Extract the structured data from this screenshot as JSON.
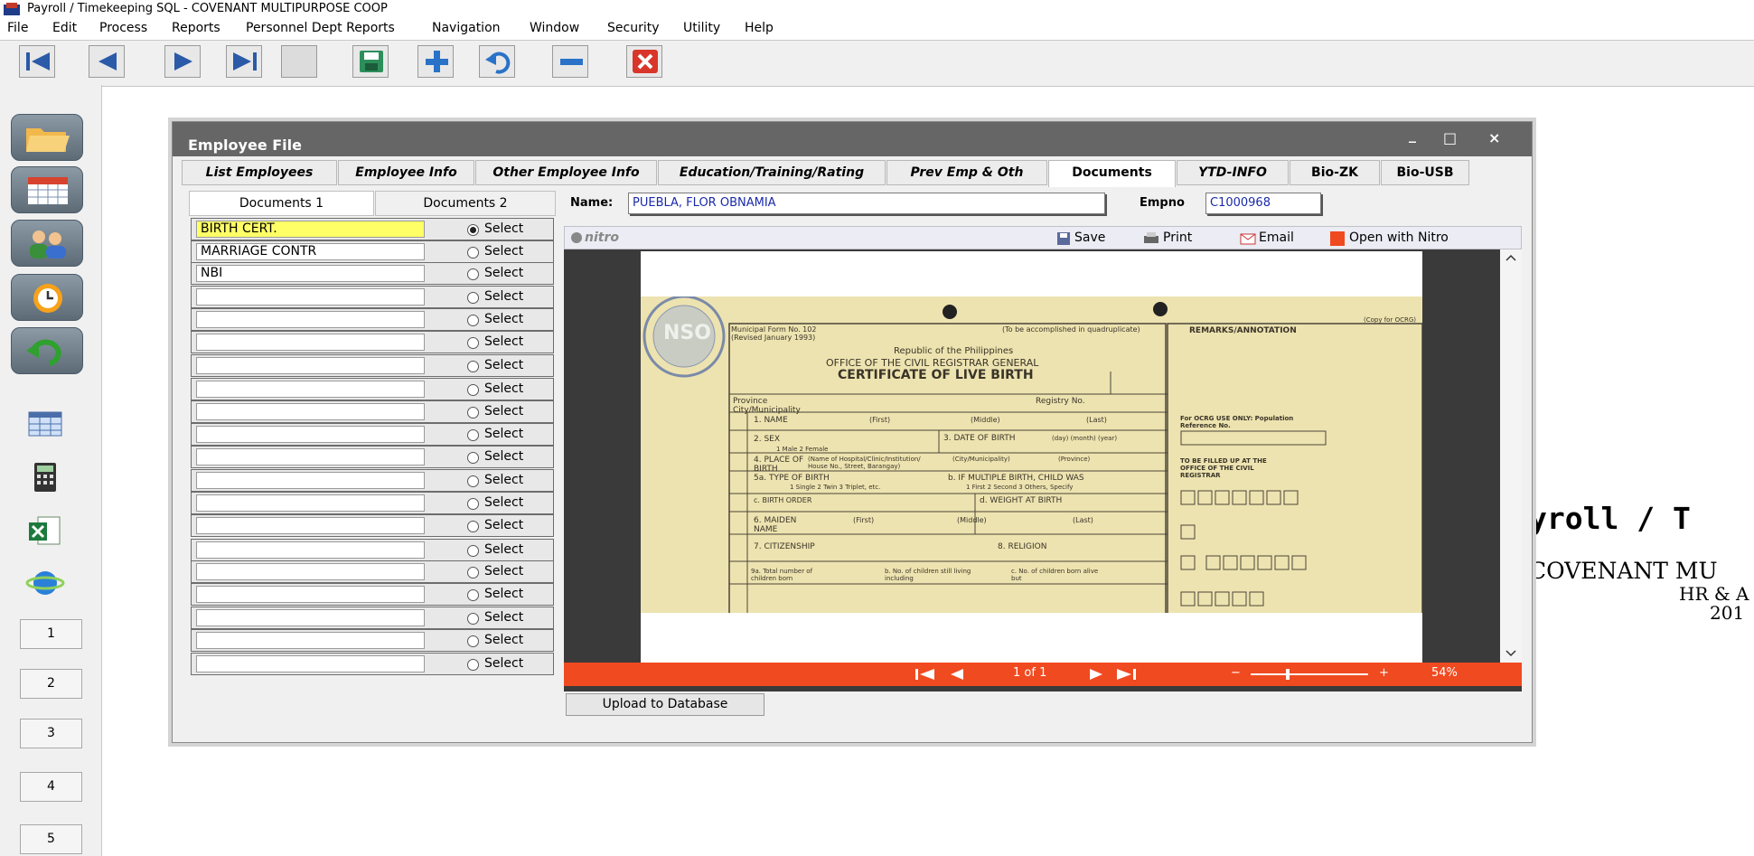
{
  "app": {
    "title": "Payroll / Timekeeping SQL - COVENANT MULTIPURPOSE COOP"
  },
  "menu": [
    "File",
    "Edit",
    "Process",
    "Reports",
    "Personnel Dept Reports",
    "Navigation",
    "Window",
    "Security",
    "Utility",
    "Help"
  ],
  "rail": {
    "numbers": [
      "1",
      "2",
      "3",
      "4",
      "5"
    ]
  },
  "background": {
    "line1": "yroll / T",
    "line2": "COVENANT MU",
    "line3": "HR & A",
    "line4": "201"
  },
  "window": {
    "title": "Employee File",
    "controls": {
      "minimize": "_",
      "maximize": "□",
      "close": "×"
    },
    "tabs": [
      "List Employees",
      "Employee Info",
      "Other Employee Info",
      "Education/Training/Rating",
      "Prev Emp & Oth",
      "Documents",
      "YTD-INFO",
      "Bio-ZK",
      "Bio-USB"
    ],
    "subtabs": [
      "Documents 1",
      "Documents 2"
    ],
    "name_label": "Name:",
    "name_value": "PUEBLA, FLOR OBNAMIA",
    "empno_label": "Empno",
    "empno_value": "C1000968",
    "select_label": "Select",
    "documents": [
      "BIRTH CERT.",
      "MARRIAGE CONTR",
      "NBI",
      "",
      "",
      "",
      "",
      "",
      "",
      "",
      "",
      "",
      "",
      "",
      "",
      "",
      "",
      "",
      "",
      ""
    ],
    "selected_index": 0,
    "upload_button": "Upload to Database"
  },
  "viewer": {
    "brand": "nitro",
    "save": "Save",
    "print": "Print",
    "email": "Email",
    "open": "Open with Nitro",
    "page_info": "1 of 1",
    "zoom": "54%",
    "zoom_level": 0.3
  },
  "certificate": {
    "form_no": "Municipal Form No. 102",
    "revised": "(Revised January 1993)",
    "copy_note": "(To be accomplished in quadruplicate)",
    "copy_for": "(Copy for OCRG)",
    "remarks": "REMARKS/ANNOTATION",
    "republic": "Republic of the Philippines",
    "office": "OFFICE OF THE CIVIL REGISTRAR GENERAL",
    "heading": "CERTIFICATE OF LIVE BIRTH",
    "province": "Province",
    "city": "City/Municipality",
    "registry": "Registry No.",
    "f1": "1. NAME",
    "f1_parts": [
      "(First)",
      "(Middle)",
      "(Last)"
    ],
    "f2": "2. SEX",
    "f2_opts": "1 Male      2 Female",
    "f3": "3. DATE OF BIRTH",
    "f3_parts": "(day)    (month)   (year)",
    "f4": "4. PLACE OF BIRTH",
    "f4_detail": "(Name of Hospital/Clinic/Institution/ House No., Street, Barangay)",
    "f4_city": "(City/Municipality)",
    "f4_prov": "(Province)",
    "f5a": "5a. TYPE OF BIRTH",
    "f5a_opts": "1 Single    2 Twin    3 Triplet, etc.",
    "f5b": "b. IF MULTIPLE BIRTH, CHILD WAS",
    "f5b_opts": "1 First    2 Second    3 Others, Specify",
    "f5c": "c. BIRTH ORDER",
    "f5d": "d. WEIGHT AT BIRTH",
    "f6": "6. MAIDEN NAME",
    "f6_parts": [
      "(First)",
      "(Middle)",
      "(Last)"
    ],
    "f7": "7. CITIZENSHIP",
    "f8": "8. RELIGION",
    "f9a": "9a. Total number of children born",
    "f9b": "b. No. of children still living including",
    "f9c": "c. No. of children born alive but",
    "ocrg": "For OCRG USE ONLY: Population Reference No.",
    "civil": "TO BE FILLED UP AT THE OFFICE OF THE CIVIL REGISTRAR",
    "seal": "NSO"
  }
}
